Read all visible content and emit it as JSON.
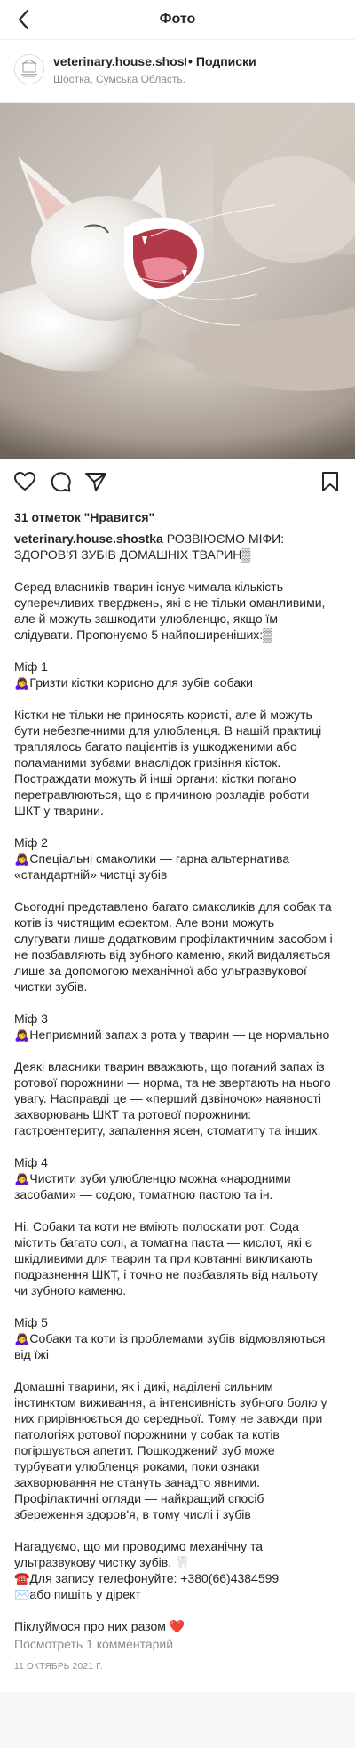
{
  "topbar": {
    "title": "Фото"
  },
  "post": {
    "username": "veterinary.house.shostka",
    "separator": "•",
    "follow_label": "Подписки",
    "location": "Шостка, Сумська Область.",
    "likes_text": "31 отметок \"Нравится\"",
    "caption_head": " РОЗВІЮЄМО МІФИ: ЗДОРОВ’Я ЗУБІВ ДОМАШНІХ ТВАРИН▒",
    "paragraphs": [
      "Серед власників тварин існує чимала кількість суперечливих тверджень, які є не тільки оманливими, але й можуть зашкодити улюбленцю, якщо їм слідувати. Пропонуємо 5 найпоширеніших:▒",
      "Міф 1\n🙇‍♀️Гризти кістки корисно для зубів собаки",
      "Кістки не тільки не приносять користі, але й можуть бути небезпечними для улюбленця. В нашій практиці траплялось багато пацієнтів із ушкодженими або поламаними зубами внаслідок гризіння кісток. Постраждати можуть й інші органи: кістки погано перетравлюються, що є причиною розладів роботи ШКТ у тварини.",
      "Міф 2\n🙇‍♀️Спеціальні смаколики — гарна альтернатива «стандартній» чистці зубів",
      "Сьогодні представлено багато смаколиків для собак та котів із чистящим ефектом. Але вони можуть слугувати лише додатковим профілактичним засобом і не позбавляють від зубного каменю, який видаляється лише за допомогою механічної або ультразвукової чистки зубів.",
      "Міф 3\n🙇‍♀️Неприємний запах з рота у тварин — це нормально",
      "Деякі власники тварин вважають, що поганий запах із ротової порожнини — норма, та не звертають на нього увагу. Насправді це — «перший дзвіночок» наявності захворювань ШКТ та ротової порожнини: гастроентериту, запалення ясен, стоматиту та інших.",
      "Міф 4\n🙇‍♀️Чистити зуби улюбленцю можна «народними засобами» — содою, томатною пастою та ін.",
      "Ні. Собаки та коти не вміють полоскати рот. Сода містить багато солі, а томатна паста — кислот, які є шкідливими для тварин та при ковтанні викликають подразнення ШКТ, і точно не позбавлять від нальоту чи зубного каменю.",
      "Міф 5\n🙇‍♀️Собаки та коти із проблемами зубів відмовляються від їжі",
      "Домашні тварини, як і дикі, наділені сильним інстинктом виживання, а інтенсивність зубного болю у них прирівнюється до середньої. Тому не завжди при патологіях ротової порожнини у собак та котів погіршується апетит. Пошкоджений зуб може турбувати улюбленця роками, поки ознаки захворювання не стануть занадто явними. Профілактичні огляди — найкращий спосіб збереження здоров'я, в тому числі і зубів",
      "Нагадуємо, що ми проводимо механічну та ультразвукову чистку зубів. 🦷\n☎️Для запису телефонуйте: +380(66)4384599\n✉️або пишіть у дірект",
      "Піклуймося про них разом ❤️"
    ],
    "view_comments": "Посмотреть 1 комментарий",
    "date": "11 ОКТЯБРЬ 2021 Г."
  },
  "icons": {
    "back": "chevron-left-icon",
    "like": "heart-icon",
    "comment": "comment-icon",
    "share": "paper-plane-icon",
    "save": "bookmark-icon"
  },
  "colors": {
    "text": "#262626",
    "muted": "#8e8e8e",
    "border": "#efefef",
    "background": "#f7f7f7"
  }
}
